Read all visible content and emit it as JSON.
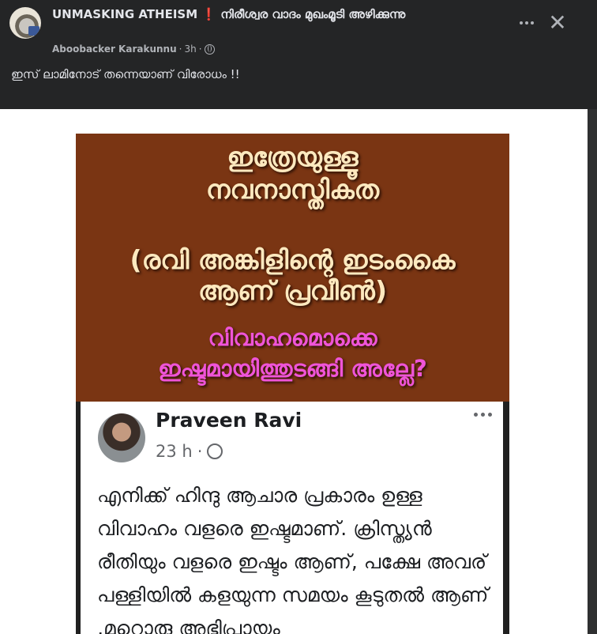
{
  "post": {
    "group_name": "UNMASKING ATHEISM",
    "group_name_suffix": "നിരീശ്വര വാദം മുഖംമൂടി അഴിക്കുന്നു",
    "exclamation_glyph": "❗",
    "author": "Aboobacker Karakunnu",
    "time": "3h",
    "audience_icon": "globe-icon",
    "caption": "ഇസ് ലാമിനോട് തന്നെയാണ് വിരോധം !!"
  },
  "banner": {
    "line1": "ഇത്രേയുള്ളൂ",
    "line2": "നവനാസ്തികത",
    "line3": "(രവി അങ്കിളിന്റെ ഇടംകൈ",
    "line4": "ആണ് പ്രവീൺ)",
    "line5": "വിവാഹമൊക്കെ",
    "line6": "ഇഷ്ടമായിത്തുടങ്ങി അല്ലേ?",
    "bg_color": "#7a3513",
    "cream_color": "#fde9bf",
    "pink_color": "#ef54d8"
  },
  "embedded_post": {
    "name": "Praveen Ravi",
    "time": "23 h",
    "text": "എനിക്ക് ഹിന്ദു ആചാര പ്രകാരം ഉള്ള വിവാഹം വളരെ ഇഷ്ടമാണ്. ക്രിസ്ത്യൻ രീതിയും വളരെ ഇഷ്ടം ആണ്, പക്ഷേ അവര് പള്ളിയിൽ കളയുന്ന സമയം കൂടുതൽ ആണ് ,മറ്റൊരു അഭിപ്രായം"
  },
  "controls": {
    "close_glyph": "✕"
  }
}
